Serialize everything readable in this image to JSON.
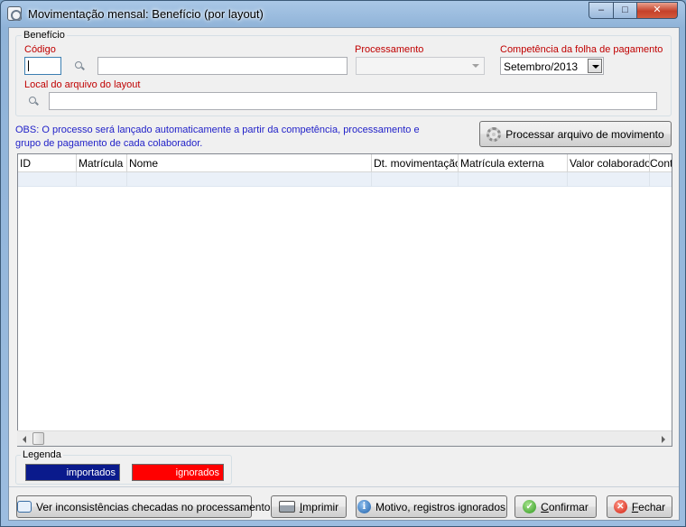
{
  "window": {
    "title": "Movimentação mensal: Benefício (por layout)",
    "controls": {
      "minimize": "–",
      "maximize": "□",
      "close": "✕"
    }
  },
  "beneficio": {
    "group_label": "Benefício",
    "codigo_label": "Código",
    "codigo_value": "",
    "descricao_value": "",
    "processamento_label": "Processamento",
    "processamento_value": "",
    "competencia_label": "Competência da folha de pagamento",
    "competencia_value": "Setembro/2013",
    "local_label": "Local do arquivo do layout",
    "local_value": ""
  },
  "obs": "OBS: O processo será lançado automaticamente a partir da competência, processamento e grupo de pagamento de cada colaborador.",
  "process_button": {
    "label": "Processar arquivo de movimento",
    "icon": "gear-icon"
  },
  "grid": {
    "columns": [
      "ID",
      "Matrícula",
      "Nome",
      "Dt. movimentação",
      "Matrícula externa",
      "Valor colaborador",
      "Contra"
    ]
  },
  "legend": {
    "label": "Legenda",
    "items": [
      {
        "label": "importados",
        "color": "#0a1a8c"
      },
      {
        "label": "ignorados",
        "color": "#ff0000"
      }
    ]
  },
  "footer": {
    "inconsistencias": {
      "label": "Ver inconsistências checadas no processamento",
      "icon": "chat-icon"
    },
    "imprimir": {
      "label_u": "I",
      "label_rest": "mprimir",
      "icon": "printer-icon"
    },
    "motivo": {
      "label": "Motivo, registros ignorados",
      "icon": "info-icon"
    },
    "confirmar": {
      "label_u": "C",
      "label_rest": "onfirmar",
      "icon": "check-icon"
    },
    "fechar": {
      "label_u": "F",
      "label_rest": "echar",
      "icon": "close-circle-icon"
    }
  },
  "colors": {
    "label_red": "#c00000",
    "obs_blue": "#1f1fc8",
    "row_highlight": "#eaf0f8"
  }
}
